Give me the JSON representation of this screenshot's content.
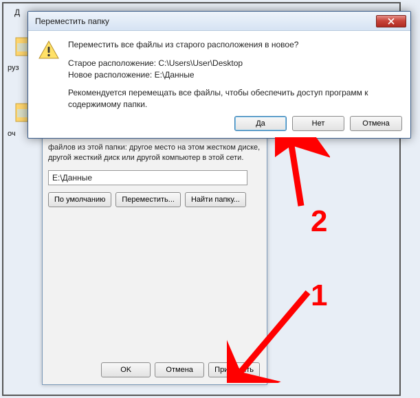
{
  "outer": {
    "partial": "Д",
    "label1": "руз",
    "label2": "оч"
  },
  "properties": {
    "help_text": "файлов из этой папки: другое место на этом жестком диске, другой жесткий диск или другой компьютер в этой сети.",
    "path_value": "E:\\Данные",
    "btn_default": "По умолчанию",
    "btn_move": "Переместить...",
    "btn_find": "Найти папку...",
    "footer_ok": "OK",
    "footer_cancel": "Отмена",
    "footer_apply": "Применить"
  },
  "dialog": {
    "title": "Переместить папку",
    "question": "Переместить все файлы из старого расположения в новое?",
    "old_label": "Старое расположение: C:\\Users\\User\\Desktop",
    "new_label": "Новое расположение: E:\\Данные",
    "recommend": "Рекомендуется перемещать все файлы, чтобы обеспечить доступ программ к содержимому папки.",
    "btn_yes": "Да",
    "btn_no": "Нет",
    "btn_cancel": "Отмена"
  },
  "annotation": {
    "one": "1",
    "two": "2"
  }
}
